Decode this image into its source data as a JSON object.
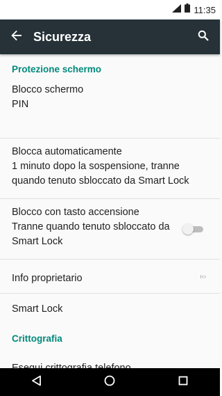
{
  "status_bar": {
    "time": "11:35"
  },
  "app_bar": {
    "title": "Sicurezza"
  },
  "sections": {
    "screen_protection": "Protezione schermo",
    "encryption": "Crittografia"
  },
  "prefs": {
    "screen_lock": {
      "title": "Blocco schermo",
      "summary": "PIN"
    },
    "auto_lock": {
      "title": "Blocca automaticamente",
      "summary": "1 minuto dopo la sospensione, tranne quando tenuto sbloccato da Smart Lock"
    },
    "power_button_lock": {
      "title": "Blocco con tasto accensione",
      "summary": "Tranne quando tenuto sbloccato da Smart Lock",
      "enabled": false
    },
    "owner_info": {
      "title": "Info proprietario",
      "widget": "ı‹› "
    },
    "smart_lock": {
      "title": "Smart Lock"
    },
    "encrypt_phone": {
      "title": "Esegui crittografia telefono"
    }
  },
  "colors": {
    "app_bar": "#263238",
    "accent": "#00897b",
    "background": "#fafafa"
  }
}
